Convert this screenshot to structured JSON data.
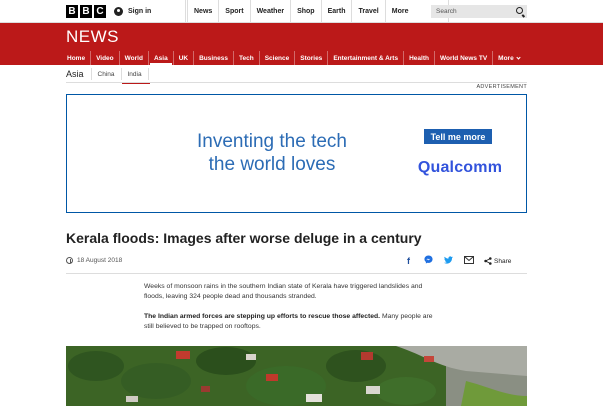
{
  "topbar": {
    "logo_letters": [
      "B",
      "B",
      "C"
    ],
    "signin_label": "Sign in",
    "nav": [
      "News",
      "Sport",
      "Weather",
      "Shop",
      "Earth",
      "Travel"
    ],
    "more_label": "More",
    "search_placeholder": "Search"
  },
  "newsbar": {
    "title": "NEWS",
    "nav": [
      "Home",
      "Video",
      "World",
      "Asia",
      "UK",
      "Business",
      "Tech",
      "Science",
      "Stories",
      "Entertainment & Arts",
      "Health",
      "World News TV"
    ],
    "active": "Asia",
    "more_label": "More",
    "color": "#bb1919"
  },
  "subnav": {
    "section": "Asia",
    "links": [
      "China",
      "India"
    ],
    "active": "India"
  },
  "ad": {
    "label": "ADVERTISEMENT",
    "headline_line1": "Inventing the tech",
    "headline_line2": "the world loves",
    "cta": "Tell me more",
    "brand": "Qualcomm"
  },
  "article": {
    "headline": "Kerala floods: Images after worse deluge in a century",
    "date": "18 August 2018",
    "share_label": "Share",
    "share_icons": [
      "facebook-icon",
      "messenger-icon",
      "twitter-icon",
      "email-icon",
      "share-icon"
    ],
    "paragraph1": "Weeks of monsoon rains in the southern Indian state of Kerala have triggered landslides and floods, leaving 324 people dead and thousands stranded.",
    "paragraph2_bold": "The Indian armed forces are stepping up efforts to rescue those affected.",
    "paragraph2_rest": " Many people are still believed to be trapped on rooftops."
  }
}
